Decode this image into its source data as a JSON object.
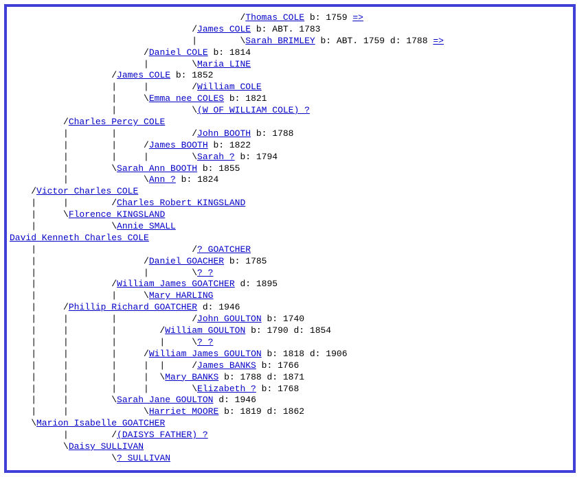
{
  "tree": [
    {
      "indent": "                                           /",
      "link": "Thomas COLE",
      "vitals": " b: 1759 ",
      "arrow": "=>"
    },
    {
      "indent": "                                  /",
      "link": "James COLE",
      "vitals": " b: ABT. 1783"
    },
    {
      "indent": "                                  |        \\",
      "link": "Sarah BRIMLEY",
      "vitals": " b: ABT. 1759 d: 1788 ",
      "arrow": "=>"
    },
    {
      "indent": "                         /",
      "link": "Daniel COLE",
      "vitals": " b: 1814"
    },
    {
      "indent": "                         |        \\",
      "link": "Maria LINE",
      "vitals": ""
    },
    {
      "indent": "                   /",
      "link": "James COLE",
      "vitals": " b: 1852"
    },
    {
      "indent": "                   |     |        /",
      "link": "William COLE",
      "vitals": ""
    },
    {
      "indent": "                   |     \\",
      "link": "Emma nee COLES",
      "vitals": " b: 1821"
    },
    {
      "indent": "                   |              \\",
      "link": "(W OF WILLIAM COLE) ?",
      "vitals": ""
    },
    {
      "indent": "          /",
      "link": "Charles Percy COLE",
      "vitals": ""
    },
    {
      "indent": "          |        |              /",
      "link": "John BOOTH",
      "vitals": " b: 1788"
    },
    {
      "indent": "          |        |     /",
      "link": "James BOOTH",
      "vitals": " b: 1822"
    },
    {
      "indent": "          |        |     |        \\",
      "link": "Sarah ?",
      "vitals": " b: 1794"
    },
    {
      "indent": "          |        \\",
      "link": "Sarah Ann BOOTH",
      "vitals": " b: 1855"
    },
    {
      "indent": "          |              \\",
      "link": "Ann ?",
      "vitals": " b: 1824"
    },
    {
      "indent": "    /",
      "link": "Victor Charles COLE",
      "vitals": ""
    },
    {
      "indent": "    |     |        /",
      "link": "Charles Robert KINGSLAND",
      "vitals": ""
    },
    {
      "indent": "    |     \\",
      "link": "Florence KINGSLAND",
      "vitals": ""
    },
    {
      "indent": "    |              \\",
      "link": "Annie SMALL",
      "vitals": ""
    },
    {
      "indent": "",
      "link": "David Kenneth Charles COLE",
      "vitals": ""
    },
    {
      "indent": "    |                             /",
      "link": "? GOATCHER",
      "vitals": ""
    },
    {
      "indent": "    |                    /",
      "link": "Daniel GOACHER",
      "vitals": " b: 1785"
    },
    {
      "indent": "    |                    |        \\",
      "link": "? ?",
      "vitals": ""
    },
    {
      "indent": "    |              /",
      "link": "William James GOATCHER",
      "vitals": " d: 1895"
    },
    {
      "indent": "    |              |     \\",
      "link": "Mary HARLING",
      "vitals": ""
    },
    {
      "indent": "    |     /",
      "link": "Phillip Richard GOATCHER",
      "vitals": " d: 1946"
    },
    {
      "indent": "    |     |        |              /",
      "link": "John GOULTON",
      "vitals": " b: 1740"
    },
    {
      "indent": "    |     |        |        /",
      "link": "William GOULTON",
      "vitals": " b: 1790 d: 1854"
    },
    {
      "indent": "    |     |        |        |     \\",
      "link": "? ?",
      "vitals": ""
    },
    {
      "indent": "    |     |        |     /",
      "link": "William James GOULTON",
      "vitals": " b: 1818 d: 1906"
    },
    {
      "indent": "    |     |        |     |  |     /",
      "link": "James BANKS",
      "vitals": " b: 1766"
    },
    {
      "indent": "    |     |        |     |  \\",
      "link": "Mary BANKS",
      "vitals": " b: 1788 d: 1871"
    },
    {
      "indent": "    |     |        |     |        \\",
      "link": "Elizabeth ?",
      "vitals": " b: 1768"
    },
    {
      "indent": "    |     |        \\",
      "link": "Sarah Jane GOULTON",
      "vitals": " d: 1946"
    },
    {
      "indent": "    |     |              \\",
      "link": "Harriet MOORE",
      "vitals": " b: 1819 d: 1862"
    },
    {
      "indent": "    \\",
      "link": "Marion Isabelle GOATCHER",
      "vitals": ""
    },
    {
      "indent": "          |        /",
      "link": "(DAISYS FATHER) ?",
      "vitals": ""
    },
    {
      "indent": "          \\",
      "link": "Daisy SULLIVAN",
      "vitals": ""
    },
    {
      "indent": "                   \\",
      "link": "? SULLIVAN",
      "vitals": ""
    }
  ]
}
